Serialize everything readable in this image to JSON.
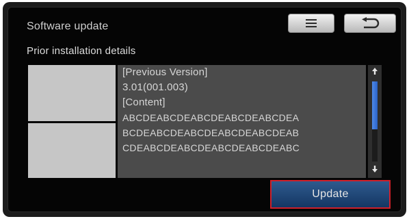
{
  "header": {
    "title": "Software update",
    "menu_icon": "menu-icon",
    "back_icon": "back-arrow-icon"
  },
  "section": {
    "label": "Prior installation details"
  },
  "details": {
    "lines": [
      "[Previous Version]",
      "3.01(001.003)",
      "[Content]",
      "ABCDEABCDEABCDEABCDEABCDEA",
      "BCDEABCDEABCDEABCDEABCDEAB",
      "CDEABCDEABCDEABCDEABCDEABC"
    ]
  },
  "scrollbar": {
    "up_icon": "scroll-up-icon",
    "down_icon": "scroll-down-icon"
  },
  "actions": {
    "update_label": "Update"
  },
  "colors": {
    "highlight_border": "#d0202a",
    "update_button": "#1f4676",
    "scroll_thumb": "#3b78dc",
    "panel": "#4b4b4b"
  }
}
